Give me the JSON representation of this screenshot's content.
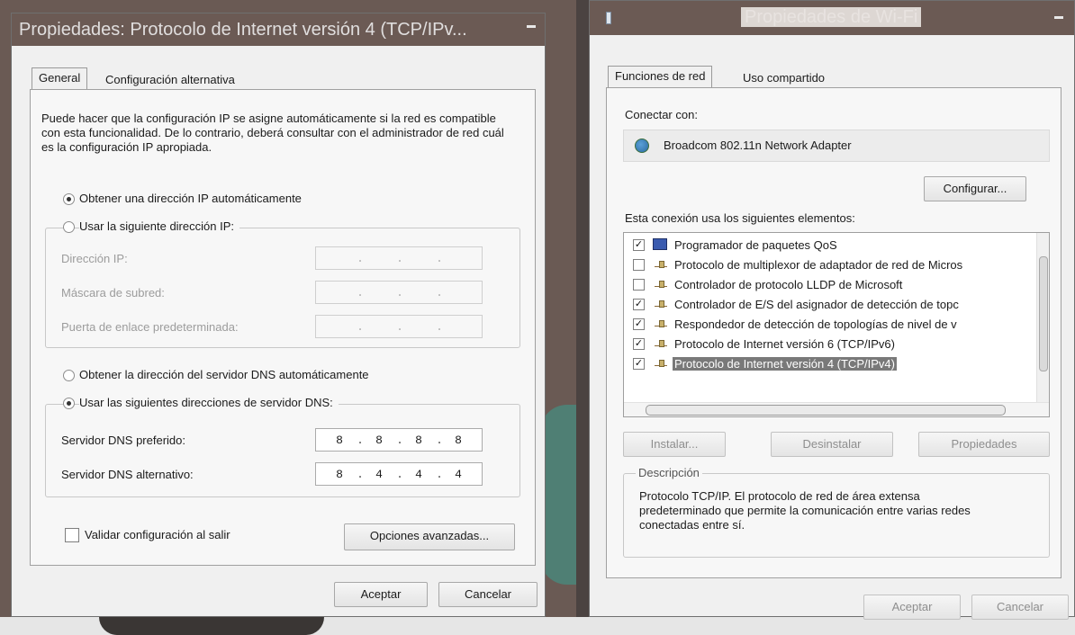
{
  "left_dialog": {
    "title": "Propiedades: Protocolo de Internet versión 4 (TCP/IPv...",
    "tabs": [
      "General",
      "Configuración alternativa"
    ],
    "description": "Puede hacer que la configuración IP se asigne automáticamente si la red es compatible con esta funcionalidad. De lo contrario, deberá consultar con el administrador de red cuál es la configuración IP apropiada.",
    "ip_auto_label": "Obtener una dirección IP automáticamente",
    "ip_manual_label": "Usar la siguiente dirección IP:",
    "ip_mode": "auto",
    "ip_address_label": "Dirección IP:",
    "subnet_label": "Máscara de subred:",
    "gateway_label": "Puerta de enlace predeterminada:",
    "dns_auto_label": "Obtener la dirección del servidor DNS automáticamente",
    "dns_manual_label": "Usar las siguientes direcciones de servidor DNS:",
    "dns_mode": "manual",
    "preferred_dns_label": "Servidor DNS preferido:",
    "preferred_dns": [
      "8",
      "8",
      "8",
      "8"
    ],
    "alternate_dns_label": "Servidor DNS alternativo:",
    "alternate_dns": [
      "8",
      "4",
      "4",
      "4"
    ],
    "validate_label": "Validar configuración al salir",
    "validate_checked": false,
    "advanced_button": "Opciones avanzadas...",
    "ok_button": "Aceptar",
    "cancel_button": "Cancelar"
  },
  "right_dialog": {
    "title": "Propiedades de Wi-Fi",
    "tabs": [
      "Funciones de red",
      "Uso compartido"
    ],
    "connect_using_label": "Conectar con:",
    "adapter_name": "Broadcom 802.11n Network Adapter",
    "configure_button": "Configurar...",
    "items_label": "Esta conexión usa los siguientes elementos:",
    "items": [
      {
        "label": "Programador de paquetes QoS",
        "checked": true,
        "icon": "qos-scheduler-icon"
      },
      {
        "label": "Protocolo de multiplexor de adaptador de red de Micros",
        "checked": false,
        "icon": "network-protocol-icon"
      },
      {
        "label": "Controlador de protocolo LLDP de Microsoft",
        "checked": false,
        "icon": "network-protocol-icon"
      },
      {
        "label": "Controlador de E/S del asignador de detección de topc",
        "checked": true,
        "icon": "network-protocol-icon"
      },
      {
        "label": "Respondedor de detección de topologías de nivel de v",
        "checked": true,
        "icon": "network-protocol-icon"
      },
      {
        "label": "Protocolo de Internet versión 6 (TCP/IPv6)",
        "checked": true,
        "icon": "network-protocol-icon"
      },
      {
        "label": "Protocolo de Internet versión 4 (TCP/IPv4)",
        "checked": true,
        "icon": "network-protocol-icon",
        "selected": true
      }
    ],
    "install_button": "Instalar...",
    "uninstall_button": "Desinstalar",
    "properties_button": "Propiedades",
    "description_legend": "Descripción",
    "description_text": "Protocolo TCP/IP. El protocolo de red de área extensa predeterminado que permite la comunicación entre varias redes conectadas entre sí.",
    "ok_button": "Aceptar",
    "cancel_button": "Cancelar"
  },
  "colors": {
    "titlebar": "#6b5a54",
    "dialog_bg": "#f0f0f0",
    "selection": "#797979"
  }
}
